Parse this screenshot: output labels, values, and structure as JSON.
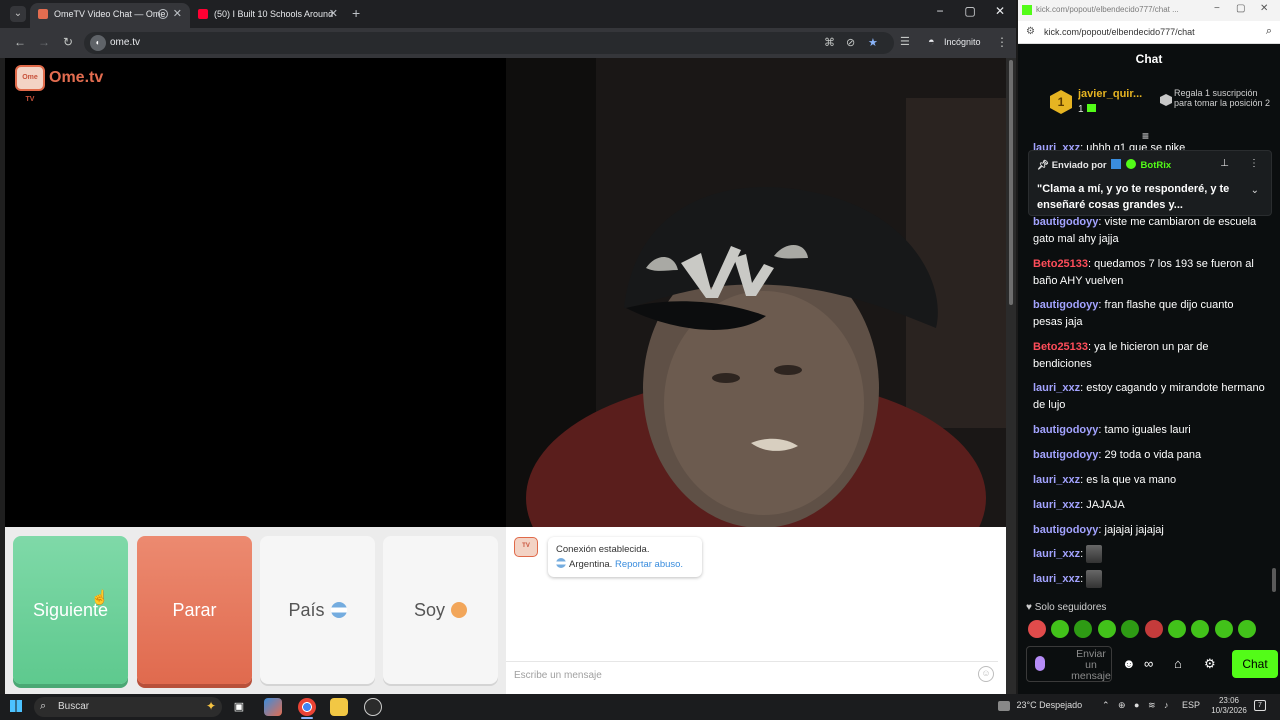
{
  "browser": {
    "tabs": [
      {
        "title": "OmeTV Video Chat — Ome",
        "active": true
      },
      {
        "title": "(50) I Built 10 Schools Around",
        "active": false
      }
    ],
    "url": "ome.tv",
    "incognito_label": "Incógnito"
  },
  "ome": {
    "logo_text": "Ome.tv",
    "logo_badge": "Ome TV",
    "buttons": {
      "next": "Siguiente",
      "stop": "Parar",
      "country": "País",
      "gender": "Soy"
    },
    "system_message": {
      "line1": "Conexión establecida.",
      "country": "Argentina.",
      "report": "Reportar abuso."
    },
    "message_placeholder": "Escribe un mensaje"
  },
  "kick": {
    "window_title": "kick.com/popout/elbendecido777/chat ...",
    "url": "kick.com/popout/elbendecido777/chat",
    "header": "Chat",
    "top_gifter": {
      "rank": "1",
      "name": "javier_quir...",
      "count": "1",
      "cta": "Regala 1 suscripción para tomar la posición 2"
    },
    "pinned": {
      "sent_by": "Enviado por",
      "bot": "BotRix",
      "text": "\"Clama a mí, y yo te responderé, y te enseñaré cosas grandes y..."
    },
    "partial_msg": {
      "user": "lauri_xxz",
      "text": "uhhh q1 que se pike"
    },
    "messages": [
      {
        "user": "bautigodoyy",
        "text": "viste me cambiaron de escuela gato mal ahy jajja"
      },
      {
        "user": "Beto25133",
        "text": "quedamos 7 los 193 se fueron al baño AHY vuelven"
      },
      {
        "user": "bautigodoyy",
        "text": "fran flashe que dijo cuanto pesas jaja"
      },
      {
        "user": "Beto25133",
        "text": "ya le hicieron un par de bendiciones"
      },
      {
        "user": "lauri_xxz",
        "text": "estoy cagando y mirandote hermano de lujo"
      },
      {
        "user": "bautigodoyy",
        "text": "tamo iguales lauri"
      },
      {
        "user": "bautigodoyy",
        "text": "29 toda o vida pana"
      },
      {
        "user": "lauri_xxz",
        "text": "es la que va mano"
      },
      {
        "user": "lauri_xxz",
        "text": "JAJAJA"
      },
      {
        "user": "bautigodoyy",
        "text": "jajajaj jajajaj"
      },
      {
        "user": "lauri_xxz",
        "text": ""
      },
      {
        "user": "lauri_xxz",
        "text": ""
      }
    ],
    "followers_only": "Solo seguidores",
    "input_placeholder": "Enviar un mensaje",
    "chat_button": "Chat",
    "colors": {
      "accent": "#53fc18",
      "user_blue": "#a3a3ff",
      "user_red": "#ff4d5a"
    }
  },
  "taskbar": {
    "search": "Buscar",
    "weather": "23°C  Despejado",
    "lang": "ESP",
    "time": "23:06",
    "date": "10/3/2026",
    "notifications": "7"
  }
}
